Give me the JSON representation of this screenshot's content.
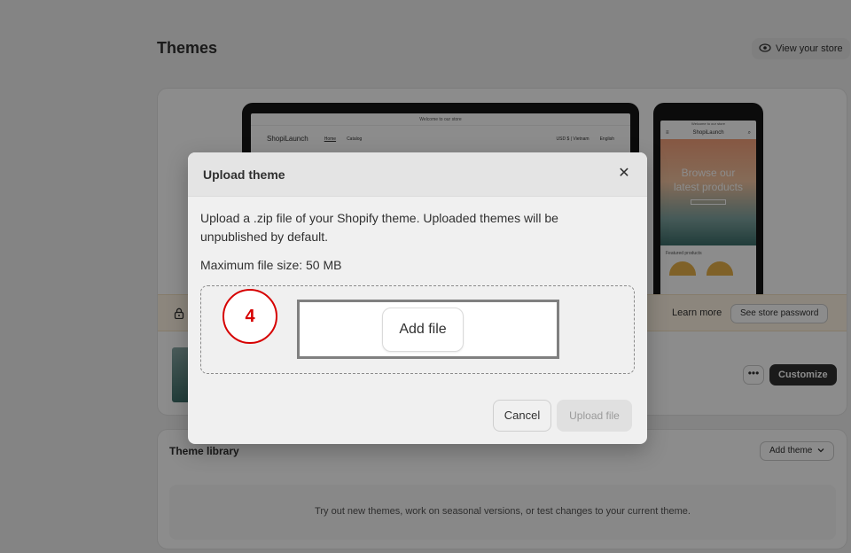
{
  "page": {
    "title": "Themes",
    "view_store_label": "View your store"
  },
  "preview": {
    "desktop_banner": "Welcome to our store",
    "desktop_brand": "ShopiLaunch",
    "desktop_nav": [
      "Home",
      "Catalog"
    ],
    "desktop_currency": "USD $ | Vietnam",
    "desktop_language": "English",
    "mobile_banner": "Welcome to our store",
    "mobile_brand": "ShopiLaunch",
    "mobile_hero_text": "Browse our latest products",
    "mobile_featured": "Featured products"
  },
  "password_bar": {
    "learn_more": "Learn more",
    "see_password": "See store password"
  },
  "current_theme": {
    "more_label": "•••",
    "customize_label": "Customize"
  },
  "library": {
    "title": "Theme library",
    "add_theme_label": "Add theme",
    "empty_text": "Try out new themes, work on seasonal versions, or test changes to your current theme."
  },
  "modal": {
    "title": "Upload theme",
    "close_label": "✕",
    "description": "Upload a .zip file of your Shopify theme. Uploaded themes will be unpublished by default.",
    "max_size": "Maximum file size: 50 MB",
    "step_number": "4",
    "add_file_label": "Add file",
    "cancel_label": "Cancel",
    "upload_label": "Upload file"
  }
}
